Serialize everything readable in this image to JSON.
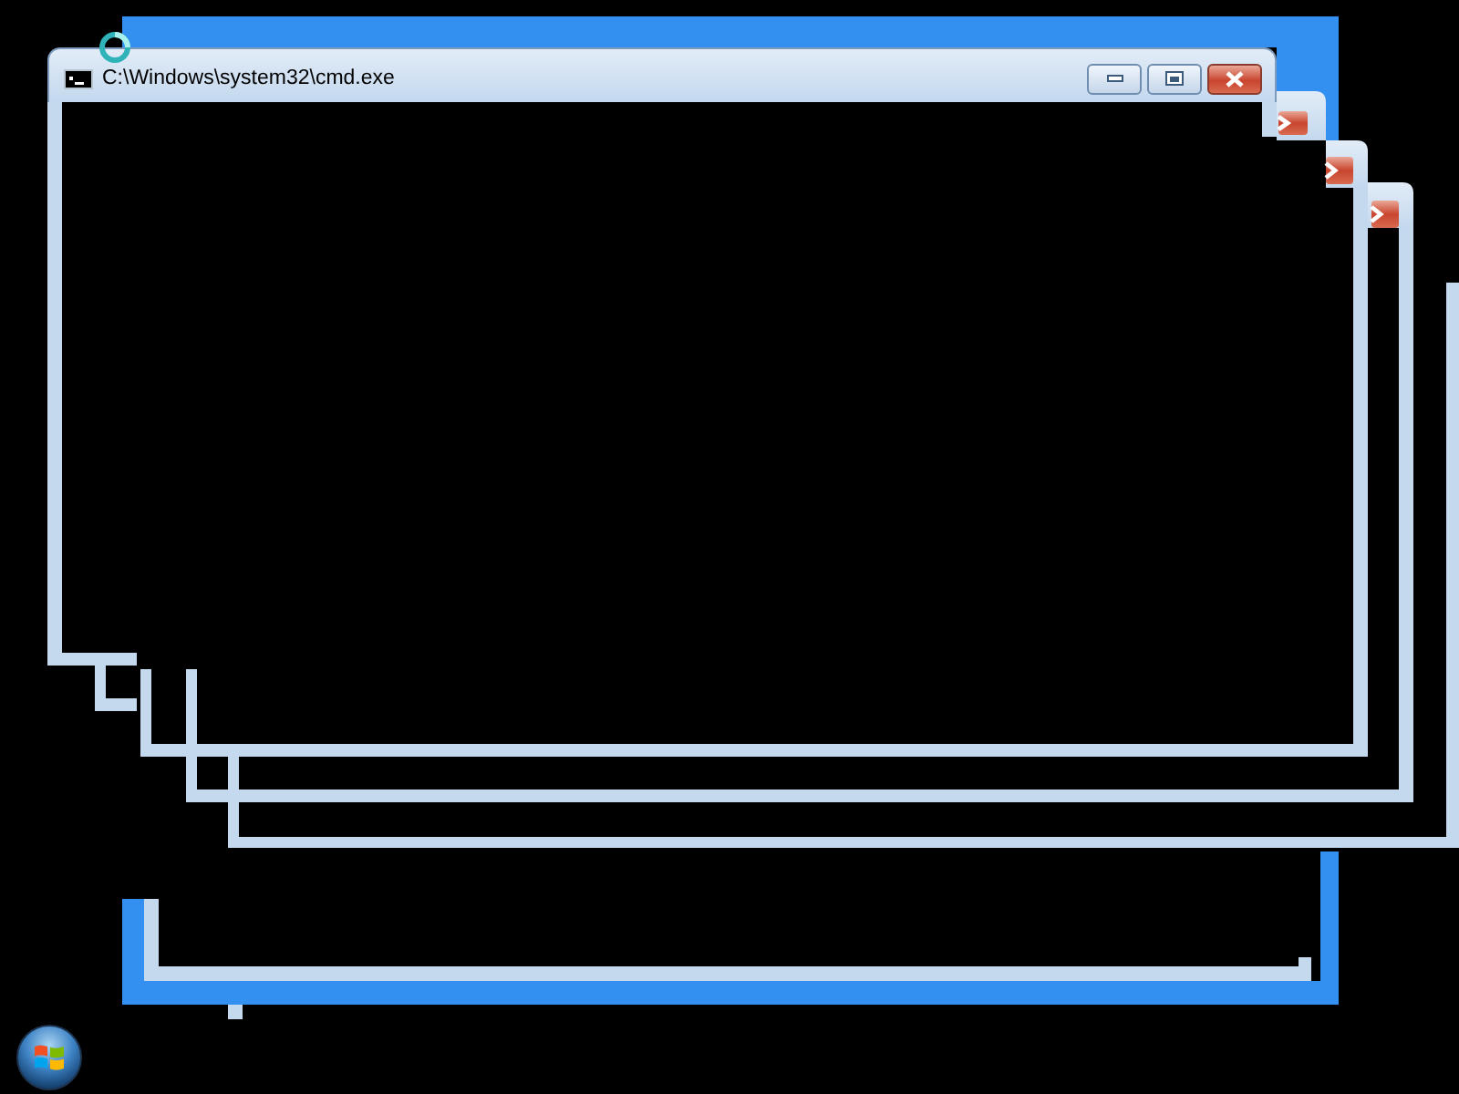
{
  "window": {
    "title": "C:\\Windows\\system32\\cmd.exe"
  }
}
